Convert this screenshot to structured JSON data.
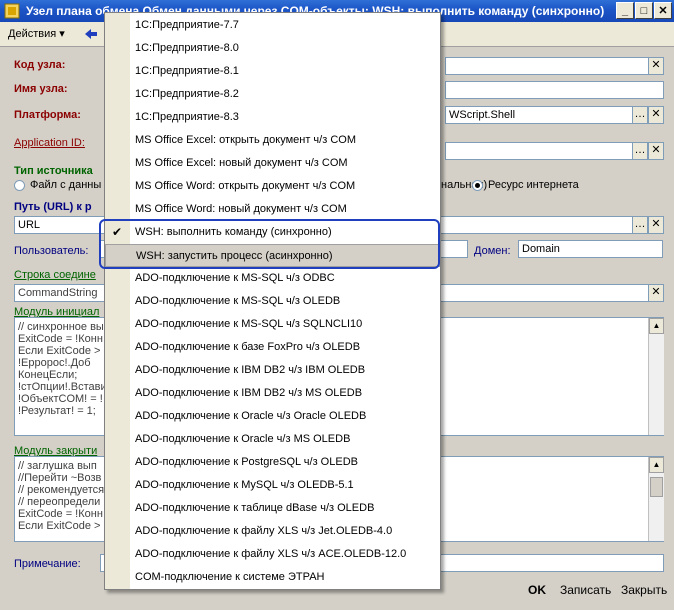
{
  "window": {
    "title": "Узел плана обмена Обмен данными через COM-объекты: WSH: выполнить команду (синхронно)",
    "min_label": "_",
    "max_label": "□",
    "close_label": "✕"
  },
  "toolbar": {
    "actions_label": "Действия ▾"
  },
  "form": {
    "node_code_label": "Код узла:",
    "node_name_label": "Имя узла:",
    "platform_label": "Платформа:",
    "platform_value": "WScript.Shell",
    "app_id_label": "Application ID:",
    "source_type_label": "Тип источника",
    "radio_file_label": "Файл с данны",
    "radio_db_label": "нальная)",
    "radio_web_label": "Ресурс интернета",
    "path_label": "Путь (URL) к р",
    "path_value": "URL",
    "user_label": "Пользователь:",
    "domain_label": "Домен:",
    "domain_value": "Domain",
    "conn_string_label": "Строка соедине",
    "conn_string_value": "CommandString",
    "init_module_label": "Модуль инициал",
    "init_module_lines": [
      "// синхронное вы",
      "ExitCode = !Конн",
      "Если ExitCode >",
      "      !Ерророс!.Доб",
      "КонецЕсли;",
      "!стОпции!.Встави",
      "!ОбъектCOM! = !",
      "!Результат! = 1;"
    ],
    "close_module_label": "Модуль закрыти",
    "close_module_lines": [
      "// заглушка вып",
      "//Перейти ~Возв",
      "// рекомендуется",
      "// переопредели",
      "ExitCode = !Конн",
      "Если ExitCode >"
    ],
    "note_label": "Примечание:"
  },
  "buttons": {
    "ok": "OK",
    "save": "Записать",
    "close": "Закрыть"
  },
  "menu": {
    "items": [
      {
        "label": "1С:Предприятие-7.7",
        "checked": false
      },
      {
        "label": "1С:Предприятие-8.0",
        "checked": false
      },
      {
        "label": "1С:Предприятие-8.1",
        "checked": false
      },
      {
        "label": "1С:Предприятие-8.2",
        "checked": false
      },
      {
        "label": "1С:Предприятие-8.3",
        "checked": false
      },
      {
        "label": "MS Office Excel: открыть документ ч/з COM",
        "checked": false
      },
      {
        "label": "MS Office Excel: новый документ ч/з COM",
        "checked": false
      },
      {
        "label": "MS Office Word: открыть документ ч/з COM",
        "checked": false
      },
      {
        "label": "MS Office Word: новый документ ч/з COM",
        "checked": false
      },
      {
        "label": "WSH: выполнить команду (синхронно)",
        "checked": true
      },
      {
        "label": "WSH: запустить процесс (асинхронно)",
        "checked": false
      },
      {
        "label": "ADO-подключение к MS-SQL ч/з ODBC",
        "checked": false
      },
      {
        "label": "ADO-подключение к MS-SQL ч/з OLEDB",
        "checked": false
      },
      {
        "label": "ADO-подключение к MS-SQL ч/з SQLNCLI10",
        "checked": false
      },
      {
        "label": "ADO-подключение к базе FoxPro ч/з OLEDB",
        "checked": false
      },
      {
        "label": "ADO-подключение к IBM DB2 ч/з IBM OLEDB",
        "checked": false
      },
      {
        "label": "ADO-подключение к IBM DB2 ч/з MS OLEDB",
        "checked": false
      },
      {
        "label": "ADO-подключение к Oracle ч/з Oracle OLEDB",
        "checked": false
      },
      {
        "label": "ADO-подключение к Oracle ч/з MS OLEDB",
        "checked": false
      },
      {
        "label": "ADO-подключение к PostgreSQL ч/з OLEDB",
        "checked": false
      },
      {
        "label": "ADO-подключение к MySQL ч/з OLEDB-5.1",
        "checked": false
      },
      {
        "label": "ADO-подключение к таблице dBase ч/з OLEDB",
        "checked": false
      },
      {
        "label": "ADO-подключение к файлу XLS ч/з Jet.OLEDB-4.0",
        "checked": false
      },
      {
        "label": "ADO-подключение к файлу XLS ч/з ACE.OLEDB-12.0",
        "checked": false
      },
      {
        "label": "COM-подключение к системе ЭТРАН",
        "checked": false
      }
    ],
    "highlighted_index": 10,
    "check_glyph": "✔"
  },
  "colors": {
    "title_bar": "#1c54c6",
    "focus_ring": "#1f3fbf",
    "label_red": "#8b0000",
    "label_green": "#006400"
  }
}
